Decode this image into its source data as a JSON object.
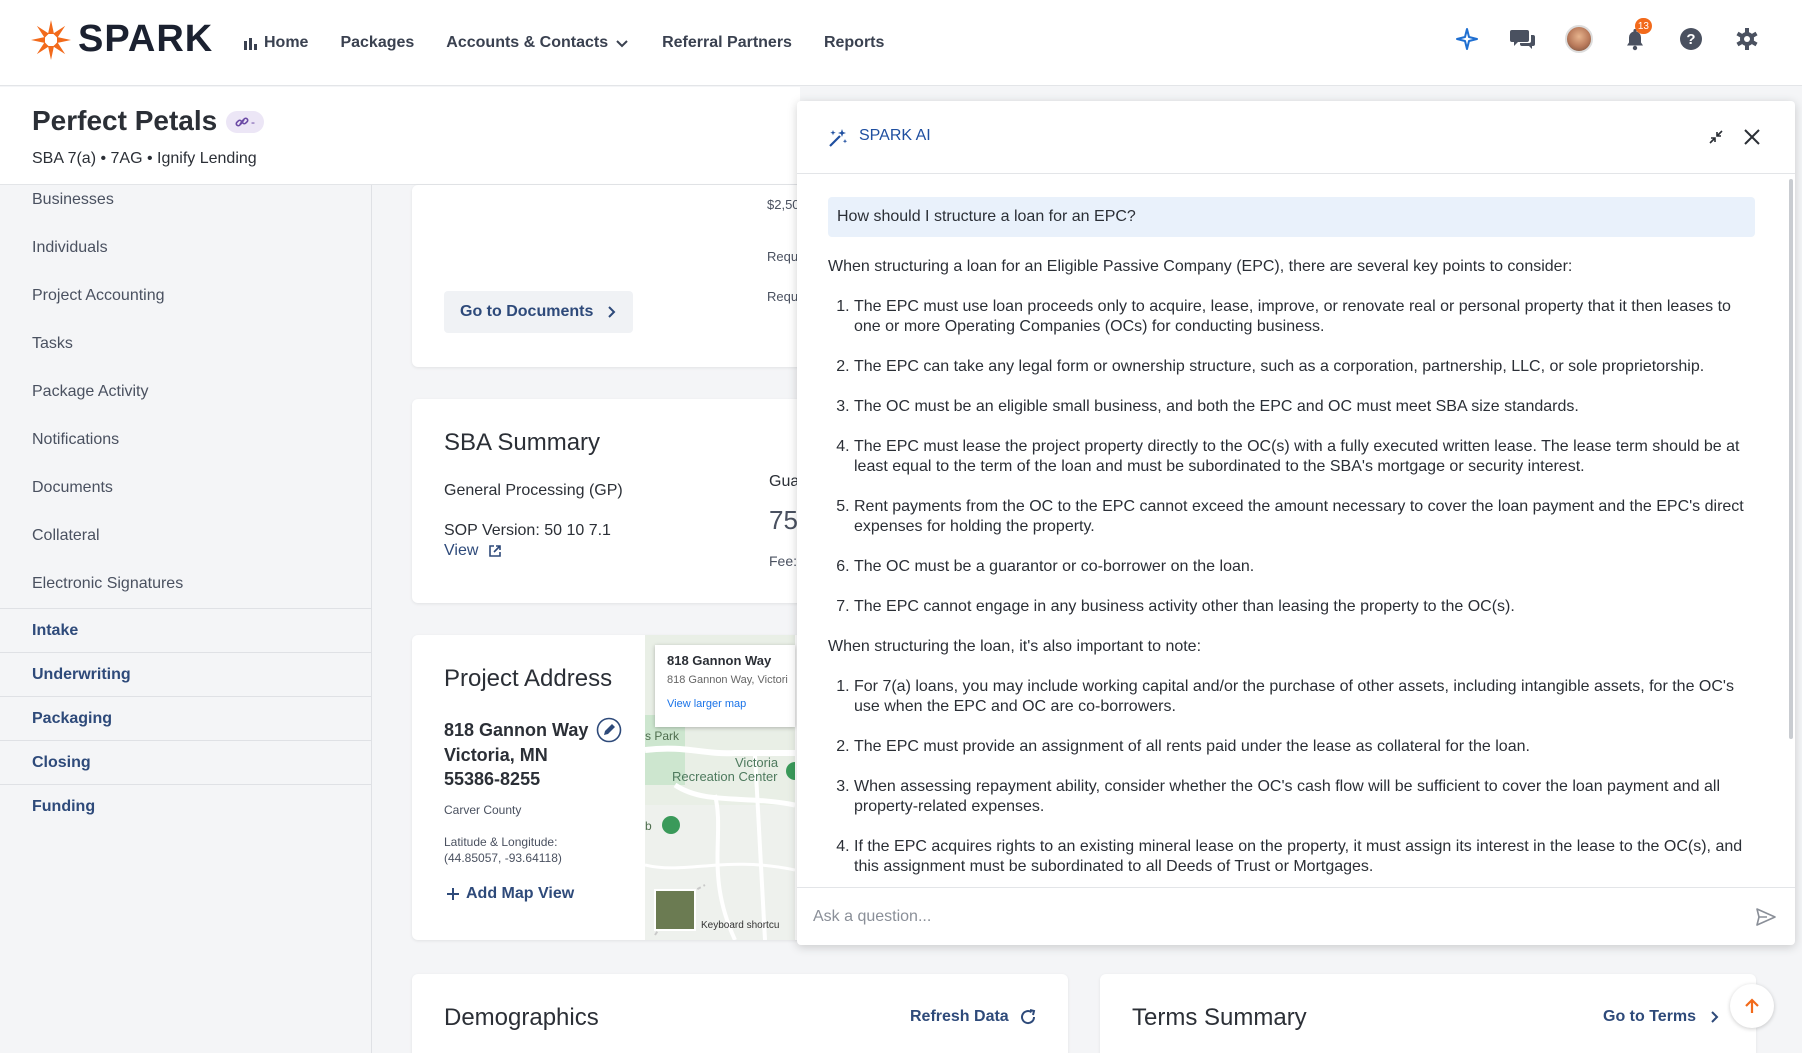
{
  "app": {
    "logo_text": "SPARK"
  },
  "nav": {
    "items": [
      {
        "label": "Home"
      },
      {
        "label": "Packages"
      },
      {
        "label": "Accounts & Contacts"
      },
      {
        "label": "Referral Partners"
      },
      {
        "label": "Reports"
      }
    ],
    "notification_count": "13"
  },
  "header": {
    "title": "Perfect Petals",
    "chip": "-",
    "subtitle": "SBA 7(a) • 7AG • Ignify Lending"
  },
  "sidebar": {
    "links": [
      "Businesses",
      "Individuals",
      "Project Accounting",
      "Tasks",
      "Package Activity",
      "Notifications",
      "Documents",
      "Collateral",
      "Electronic Signatures"
    ],
    "sections": [
      "Intake",
      "Underwriting",
      "Packaging",
      "Closing",
      "Funding"
    ]
  },
  "documents_card": {
    "button": "Go to Documents",
    "partial_amount": "$2,50",
    "partial_req1": "Requ",
    "partial_req2": "Requ"
  },
  "sba_summary": {
    "title": "SBA Summary",
    "processing": "General Processing (GP)",
    "sop_version": "SOP Version: 50 10 7.1",
    "view_link": "View",
    "partial_gua": "Gua",
    "partial_value": "75",
    "partial_fee": "Fee:"
  },
  "project_address": {
    "title": "Project Address",
    "street": "818 Gannon Way",
    "city": "Victoria, MN",
    "zip": "55386-8255",
    "county": "Carver County",
    "latlng_label": "Latitude & Longitude:",
    "latlng_value": "(44.85057, -93.64118)",
    "add_map": "Add Map View",
    "map": {
      "info_title": "818 Gannon Way",
      "info_sub": "818 Gannon Way, Victori",
      "info_link": "View larger map",
      "label_park": "s Park",
      "label_rec1": "Victoria",
      "label_rec2": "Recreation Center",
      "label_b": "b",
      "label_vic": "Vic",
      "keyboard": "Keyboard shortcu"
    }
  },
  "demographics": {
    "title": "Demographics",
    "refresh": "Refresh Data"
  },
  "terms": {
    "title": "Terms Summary",
    "goto": "Go to Terms"
  },
  "ai": {
    "title": "SPARK AI",
    "question": "How should I structure a loan for an EPC?",
    "intro": "When structuring a loan for an Eligible Passive Company (EPC), there are several key points to consider:",
    "points1": [
      "The EPC must use loan proceeds only to acquire, lease, improve, or renovate real or personal property that it then leases to one or more Operating Companies (OCs) for conducting business.",
      "The EPC can take any legal form or ownership structure, such as a corporation, partnership, LLC, or sole proprietorship.",
      "The OC must be an eligible small business, and both the EPC and OC must meet SBA size standards.",
      "The EPC must lease the project property directly to the OC(s) with a fully executed written lease. The lease term should be at least equal to the term of the loan and must be subordinated to the SBA's mortgage or security interest.",
      "Rent payments from the OC to the EPC cannot exceed the amount necessary to cover the loan payment and the EPC's direct expenses for holding the property.",
      "The OC must be a guarantor or co-borrower on the loan.",
      "The EPC cannot engage in any business activity other than leasing the property to the OC(s)."
    ],
    "middle": "When structuring the loan, it's also important to note:",
    "points2": [
      "For 7(a) loans, you may include working capital and/or the purchase of other assets, including intangible assets, for the OC's use when the EPC and OC are co-borrowers.",
      "The EPC must provide an assignment of all rents paid under the lease as collateral for the loan.",
      "When assessing repayment ability, consider whether the OC's cash flow will be sufficient to cover the loan payment and all property-related expenses.",
      "If the EPC acquires rights to an existing mineral lease on the property, it must assign its interest in the lease to the OC(s), and this assignment must be subordinated to all Deeds of Trust or Mortgages."
    ],
    "input_placeholder": "Ask a question..."
  },
  "colors": {
    "brand_orange": "#f26a1b",
    "link_blue": "#2e4a7a",
    "ai_blue": "#1f4fa0"
  }
}
